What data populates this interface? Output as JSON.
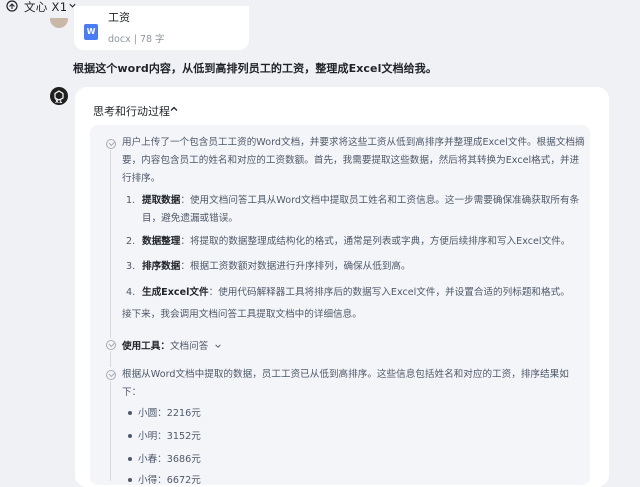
{
  "header": {
    "app_title": "文心 X1"
  },
  "file": {
    "name": "工资",
    "type": "docx",
    "size": "78 字",
    "icon_letter": "W"
  },
  "user": {
    "question": "根据这个word内容，从低到高排列员工的工资，整理成Excel文档给我。"
  },
  "bot": {
    "badge": "X1"
  },
  "process": {
    "header": "思考和行动过程",
    "intro_lines": [
      "用户上传了一个包含员工工资的Word文档，并要求将这些工资从低到高排序并整理成Excel文件。根据文档摘",
      "要，内容包含员工的姓名和对应的工资数额。首先，我需要提取这些数据，然后将其转换为Excel格式，并进",
      "行排序。"
    ],
    "steps": [
      {
        "num": "1.",
        "title": "提取数据",
        "text_line1": "：使用文档问答工具从Word文档中提取员工姓名和工资信息。这一步需要确保准确获取所有条",
        "text_line2": "目，避免遗漏或错误。"
      },
      {
        "num": "2.",
        "title": "数据整理",
        "text_line1": "：将提取的数据整理成结构化的格式，通常是列表或字典，方便后续排序和写入Excel文件。"
      },
      {
        "num": "3.",
        "title": "排序数据",
        "text_line1": "：根据工资数额对数据进行升序排列，确保从低到高。"
      },
      {
        "num": "4.",
        "title": "生成Excel文件",
        "text_line1": "：使用代码解释器工具将排序后的数据写入Excel文件，并设置合适的列标题和格式。"
      }
    ],
    "next": "接下来，我会调用文档问答工具提取文档中的详细信息。",
    "tool": {
      "label": "使用工具",
      "name": "文档问答"
    },
    "result_lines": [
      "根据从Word文档中提取的数据，员工工资已从低到高排序。这些信息包括姓名和对应的工资，排序结果如",
      "下："
    ],
    "salaries": [
      "小圆：2216元",
      "小明：3152元",
      "小春：3686元",
      "小得：6672元"
    ]
  }
}
